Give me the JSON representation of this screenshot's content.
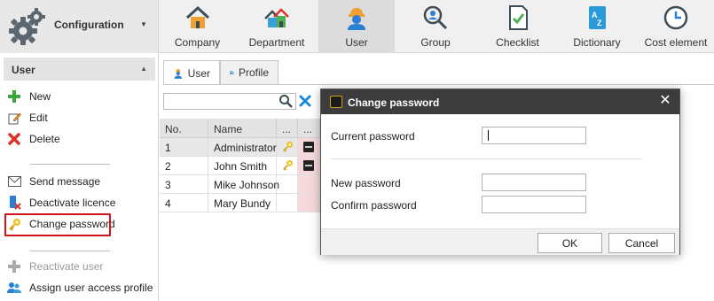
{
  "config": {
    "title": "Configuration"
  },
  "tabs": [
    {
      "label": "Company"
    },
    {
      "label": "Department"
    },
    {
      "label": "User"
    },
    {
      "label": "Group"
    },
    {
      "label": "Checklist"
    },
    {
      "label": "Dictionary"
    },
    {
      "label": "Cost element"
    }
  ],
  "sidebar": {
    "header": "User",
    "items": [
      {
        "label": "New"
      },
      {
        "label": "Edit"
      },
      {
        "label": "Delete"
      },
      {
        "label": "Send message"
      },
      {
        "label": "Deactivate licence"
      },
      {
        "label": "Change password"
      },
      {
        "label": "Reactivate user"
      },
      {
        "label": "Assign user access profile"
      }
    ]
  },
  "content_tabs": [
    {
      "label": "User"
    },
    {
      "label": "Profile"
    }
  ],
  "grid": {
    "columns": [
      "No.",
      "Name",
      "...",
      "..."
    ],
    "rows": [
      {
        "no": "1",
        "name": "Administrator"
      },
      {
        "no": "2",
        "name": "John Smith"
      },
      {
        "no": "3",
        "name": "Mike Johnson"
      },
      {
        "no": "4",
        "name": "Mary Bundy"
      }
    ]
  },
  "dialog": {
    "title": "Change password",
    "current_label": "Current password",
    "new_label": "New password",
    "confirm_label": "Confirm password",
    "ok_label": "OK",
    "cancel_label": "Cancel"
  },
  "colors": {
    "highlight": "#d4141b",
    "dialog_title_bg": "#3c3c3c",
    "add_green": "#3aa83a",
    "delete_red": "#d9322b",
    "icon_blue": "#2a7fd4"
  }
}
